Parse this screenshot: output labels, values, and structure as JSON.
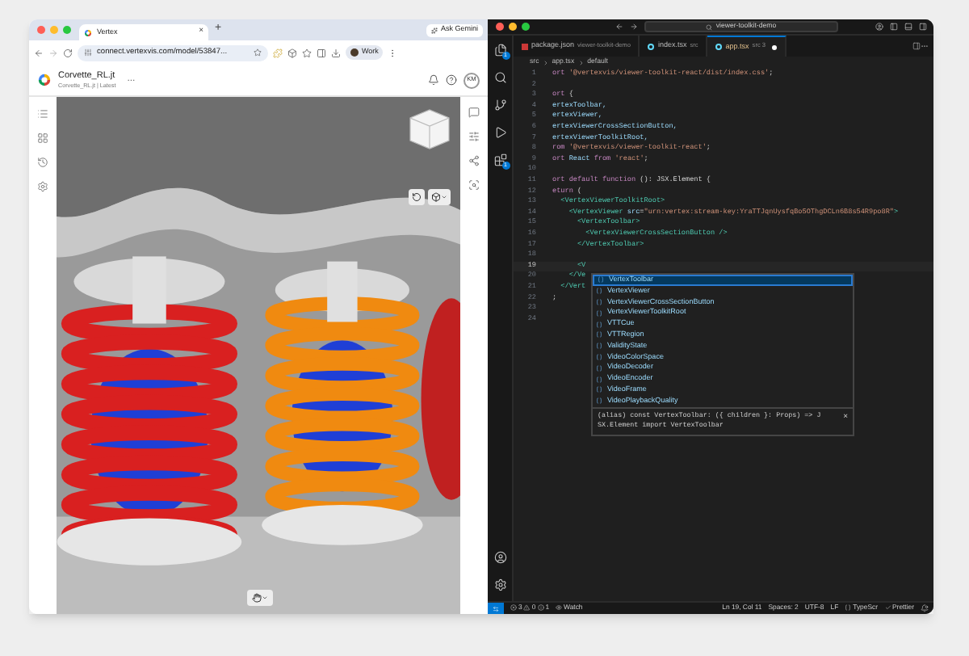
{
  "browser": {
    "tab": {
      "title": "Vertex",
      "close": "×"
    },
    "new_tab": "+",
    "ask_button": "Ask Gemini",
    "url": "connect.vertexvis.com/model/53847...",
    "profile": "Work",
    "app": {
      "title": "Corvette_RL.jt",
      "subtitle": "Corvette_RL.jt | Latest",
      "more": "...",
      "avatar": "KM"
    }
  },
  "editor": {
    "search": "viewer-toolkit-demo",
    "activity_badges": [
      "1",
      "1"
    ],
    "tabs": [
      {
        "name": "package.json",
        "detail": "viewer-toolkit-demo",
        "kind": "json",
        "selected": false,
        "modified": false
      },
      {
        "name": "index.tsx",
        "detail": "src",
        "kind": "tsx",
        "selected": false,
        "modified": false
      },
      {
        "name": "app.tsx",
        "detail": "src 3",
        "kind": "tsx",
        "selected": true,
        "modified": true
      }
    ],
    "breadcrumb": [
      "src",
      "app.tsx",
      "default"
    ],
    "lines": [
      {
        "number": "1",
        "parts": [
          {
            "kind": "keyword",
            "text": "ort "
          },
          {
            "kind": "string",
            "text": "'@vertexvis/viewer-toolkit-react/dist/index.css'"
          },
          {
            "kind": "plain",
            "text": ";"
          }
        ]
      },
      {
        "number": "2"
      },
      {
        "number": "3",
        "parts": [
          {
            "kind": "keyword",
            "text": "ort "
          },
          {
            "kind": "plain",
            "text": "{"
          }
        ]
      },
      {
        "number": "4",
        "parts": [
          {
            "kind": "ident",
            "text": "ertexToolbar,"
          }
        ]
      },
      {
        "number": "5",
        "parts": [
          {
            "kind": "ident",
            "text": "ertexViewer,"
          }
        ]
      },
      {
        "number": "6",
        "parts": [
          {
            "kind": "ident",
            "text": "ertexViewerCrossSectionButton,"
          }
        ]
      },
      {
        "number": "7",
        "parts": [
          {
            "kind": "ident",
            "text": "ertexViewerToolkitRoot,"
          }
        ]
      },
      {
        "number": "8",
        "parts": [
          {
            "kind": "keyword",
            "text": "rom "
          },
          {
            "kind": "string",
            "text": "'@vertexvis/viewer-toolkit-react'"
          },
          {
            "kind": "plain",
            "text": ";"
          }
        ]
      },
      {
        "number": "9",
        "parts": [
          {
            "kind": "keyword",
            "text": "ort "
          },
          {
            "kind": "ident",
            "text": "React "
          },
          {
            "kind": "keyword",
            "text": "from "
          },
          {
            "kind": "string",
            "text": "'react'"
          },
          {
            "kind": "plain",
            "text": ";"
          }
        ]
      },
      {
        "number": "10"
      },
      {
        "number": "11",
        "parts": [
          {
            "kind": "keyword",
            "text": "ort default function "
          },
          {
            "kind": "plain",
            "text": "(): JSX.Element {"
          }
        ]
      },
      {
        "number": "12",
        "parts": [
          {
            "kind": "keyword",
            "text": "eturn "
          },
          {
            "kind": "plain",
            "text": "("
          }
        ]
      },
      {
        "number": "13",
        "parts": [
          {
            "kind": "tag",
            "text": "  <VertexViewerToolkitRoot>"
          }
        ]
      },
      {
        "number": "14",
        "parts": [
          {
            "kind": "tag",
            "text": "    <VertexViewer "
          },
          {
            "kind": "ident",
            "text": "src"
          },
          {
            "kind": "plain",
            "text": "="
          },
          {
            "kind": "string",
            "text": "\"urn:vertex:stream-key:YraTTJqnUysfqBo5OThgDCLn6B8s54R9po8R\""
          },
          {
            "kind": "tag",
            "text": ">"
          }
        ]
      },
      {
        "number": "15",
        "parts": [
          {
            "kind": "tag",
            "text": "      <VertexToolbar>"
          }
        ]
      },
      {
        "number": "16",
        "parts": [
          {
            "kind": "tag",
            "text": "        <VertexViewerCrossSectionButton />"
          }
        ]
      },
      {
        "number": "17",
        "parts": [
          {
            "kind": "tag",
            "text": "      </VertexToolbar>"
          }
        ]
      },
      {
        "number": "18"
      },
      {
        "number": "19",
        "current": true,
        "parts": [
          {
            "kind": "tag",
            "text": "      <V"
          }
        ]
      },
      {
        "number": "20",
        "parts": [
          {
            "kind": "tag",
            "text": "    </Ve"
          }
        ]
      },
      {
        "number": "21",
        "parts": [
          {
            "kind": "tag",
            "text": "  </Vert"
          }
        ]
      },
      {
        "number": "22",
        "parts": [
          {
            "kind": "plain",
            "text": ";"
          }
        ]
      },
      {
        "number": "23"
      },
      {
        "number": "24"
      }
    ],
    "suggestions": [
      {
        "label": "VertexToolbar",
        "selected": true
      },
      {
        "label": "VertexViewer",
        "selected": false
      },
      {
        "label": "VertexViewerCrossSectionButton",
        "selected": false
      },
      {
        "label": "VertexViewerToolkitRoot",
        "selected": false
      },
      {
        "label": "VTTCue",
        "selected": false
      },
      {
        "label": "VTTRegion",
        "selected": false
      },
      {
        "label": "ValidityState",
        "selected": false
      },
      {
        "label": "VideoColorSpace",
        "selected": false
      },
      {
        "label": "VideoDecoder",
        "selected": false
      },
      {
        "label": "VideoEncoder",
        "selected": false
      },
      {
        "label": "VideoFrame",
        "selected": false
      },
      {
        "label": "VideoPlaybackQuality",
        "selected": false
      }
    ],
    "suggestion_detail": [
      "(alias) const VertexToolbar: ({ children }: Props) => J",
      "SX.Element import VertexToolbar"
    ],
    "suggestion_close": "×",
    "status": {
      "errors": "3",
      "warnings": "0",
      "infos": "1",
      "watch": "Watch",
      "items": [
        "Ln 19, Col 11",
        "Spaces: 2",
        "UTF-8",
        "LF"
      ],
      "language": "TypeScr",
      "formatter": "Prettier"
    }
  }
}
